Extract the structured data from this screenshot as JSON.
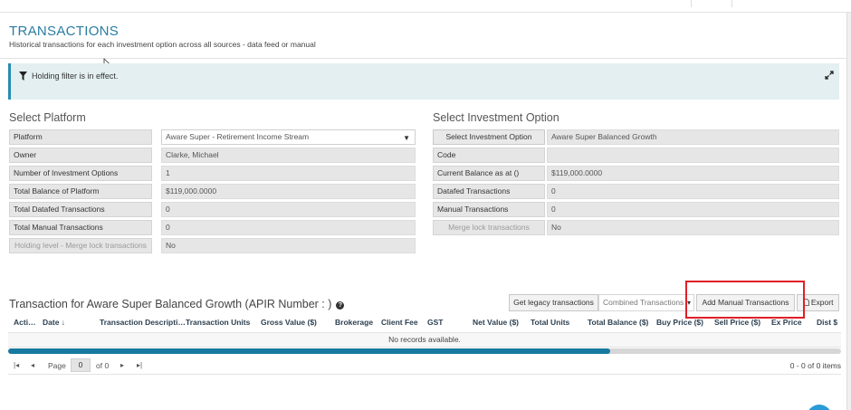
{
  "header": {
    "title": "TRANSACTIONS",
    "subtitle": "Historical transactions for each investment option across all sources - data feed or manual"
  },
  "filter_banner": {
    "text": "Holding filter is in effect."
  },
  "platform": {
    "section_title": "Select Platform",
    "rows": [
      {
        "label": "Platform",
        "value": "Aware Super - Retirement Income Stream"
      },
      {
        "label": "Owner",
        "value": "Clarke, Michael"
      },
      {
        "label": "Number of Investment Options",
        "value": "1"
      },
      {
        "label": "Total Balance of Platform",
        "value": "$119,000.0000"
      },
      {
        "label": "Total Datafed Transactions",
        "value": "0"
      },
      {
        "label": "Total Manual Transactions",
        "value": "0"
      },
      {
        "label": "Holding level - Merge lock transactions",
        "value": "No"
      }
    ]
  },
  "investment": {
    "section_title": "Select Investment Option",
    "rows": [
      {
        "label": "Select Investment Option",
        "value": "Aware Super Balanced Growth"
      },
      {
        "label": "Code",
        "value": ""
      },
      {
        "label": "Current Balance as at ()",
        "value": "$119,000.0000"
      },
      {
        "label": "Datafed Transactions",
        "value": "0"
      },
      {
        "label": "Manual Transactions",
        "value": "0"
      },
      {
        "label": "Merge lock transactions",
        "value": "No"
      }
    ]
  },
  "transactions": {
    "title": "Transaction for Aware Super Balanced Growth (APIR Number : )",
    "legacy_button": "Get legacy transactions",
    "view_select": "Combined Transactions",
    "add_manual_button": "Add Manual Transactions",
    "export_button": "Export",
    "columns": [
      "Acti…",
      "Date ↓",
      "Transaction Descripti…",
      "Transaction Units",
      "Gross Value ($)",
      "Brokerage",
      "Client Fee",
      "GST",
      "Net Value ($)",
      "Total Units",
      "Total Balance ($)",
      "Buy Price ($)",
      "Sell Price ($)",
      "Ex Price",
      "Dist $"
    ],
    "empty_message": "No records available.",
    "pager": {
      "page_label": "Page",
      "page_value": "0",
      "of_label": "of 0",
      "items_info": "0 - 0 of 0 items"
    }
  }
}
